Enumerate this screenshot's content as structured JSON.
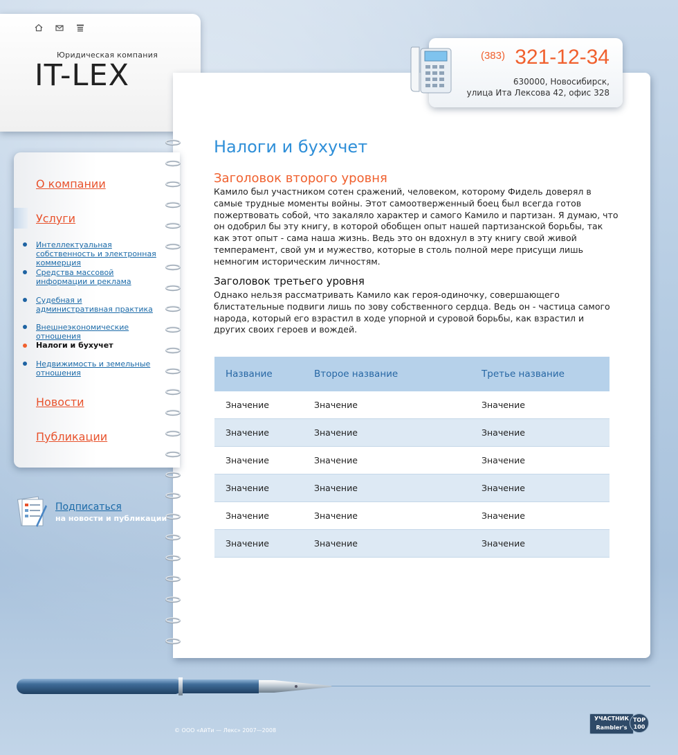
{
  "header": {
    "icons": [
      "home-icon",
      "mail-icon",
      "sitemap-icon"
    ],
    "company_caption": "Юридическая компания",
    "logo_text": "IT-LEX"
  },
  "contact": {
    "phone_code": "(383)",
    "phone_number": "321-12-34",
    "address_line1": "630000, Новосибирск,",
    "address_line2": "улица Ита Лексова 42, офис 328"
  },
  "menu": {
    "top_items": [
      {
        "label": "О компании"
      },
      {
        "label": "Услуги"
      },
      {
        "label": "Новости"
      },
      {
        "label": "Публикации"
      }
    ],
    "sub_items": [
      {
        "label": "Интеллектуальная собственность и электронная коммерция",
        "active": false
      },
      {
        "label": "Средства массовой информации и реклама",
        "active": false
      },
      {
        "label": "Судебная и административная практика",
        "active": false
      },
      {
        "label": "Внешнеэкономические отношения",
        "active": false
      },
      {
        "label": "Налоги и бухучет",
        "active": true
      },
      {
        "label": "Недвижимость и земельные отношения",
        "active": false
      }
    ]
  },
  "subscribe": {
    "link": "Подписаться",
    "sub": "на новости и публикации"
  },
  "main": {
    "title": "Налоги и бухучет",
    "h2": "Заголовок второго уровня",
    "paragraph1": "Камило был участником сотен сражений, человеком, которому Фидель доверял в самые трудные моменты войны. Этот самоотверженный боец был всегда готов пожертвовать собой, что закаляло характер и самого Камило и партизан. Я думаю, что он одобрил бы эту книгу, в которой обобщен опыт нашей партизанской борьбы, так как этот опыт - сама наша жизнь. Ведь это он вдохнул в эту книгу свой живой темперамент, свой ум и мужество, которые в столь полной мере присущи лишь немногим историческим личностям.",
    "h3": "Заголовок третьего уровня",
    "paragraph2": "Однако нельзя рассматривать Камило как героя-одиночку, совершающего блистательные подвиги лишь по зову собственного сердца. Ведь он - частица самого народа, который его взрастил в ходе упорной и суровой борьбы, как взрастил и других своих героев и вождей.",
    "table": {
      "headers": [
        "Название",
        "Второе название",
        "Третье название"
      ],
      "rows": [
        [
          "Значение",
          "Значение",
          "Значение"
        ],
        [
          "Значение",
          "Значение",
          "Значение"
        ],
        [
          "Значение",
          "Значение",
          "Значение"
        ],
        [
          "Значение",
          "Значение",
          "Значение"
        ],
        [
          "Значение",
          "Значение",
          "Значение"
        ],
        [
          "Значение",
          "Значение",
          "Значение"
        ]
      ]
    }
  },
  "footer": {
    "copyright": "© ООО «АйТи — Лекс» 2007—2008",
    "badge_left_line1": "УЧАСТНИК",
    "badge_left_line2": "Rambler's",
    "badge_circle_line1": "TOP",
    "badge_circle_line2": "100"
  },
  "colors": {
    "accent_orange": "#f0602e",
    "title_blue": "#2f8fd8",
    "link_blue": "#1b6aa8",
    "table_header_bg": "#b6d1ea"
  }
}
